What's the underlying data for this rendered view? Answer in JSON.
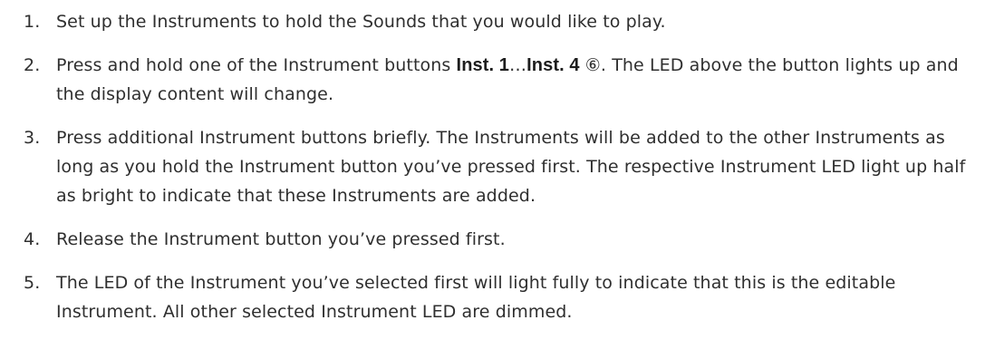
{
  "steps": [
    {
      "number": "1.",
      "text": "Set up the Instruments to hold the Sounds that you would like to play."
    },
    {
      "number": "2.",
      "text_before": "Press and hold one of the Instrument buttons ",
      "bold_1": "Inst. 1",
      "ellipsis": "…",
      "bold_2": "Inst. 4",
      "ref_marker": "⑥",
      "text_after": ". The LED above the button lights up and the display content will change."
    },
    {
      "number": "3.",
      "text": "Press additional Instrument buttons briefly. The Instruments will be added to the other Instruments as long as you hold the Instrument button you’ve pressed first. The respective Instrument LED light up half as bright to indicate that these Instruments are added."
    },
    {
      "number": "4.",
      "text": "Release the Instrument button you’ve pressed first."
    },
    {
      "number": "5.",
      "text": "The LED of the Instrument you’ve selected first will light fully to indicate that this is the editable Instrument. All other selected Instrument LED are dimmed."
    }
  ]
}
